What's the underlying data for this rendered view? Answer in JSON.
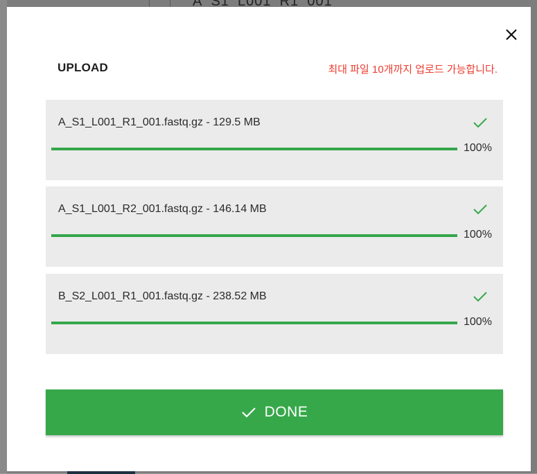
{
  "background": {
    "peek_text": "A_S1_L001_R1_001"
  },
  "modal": {
    "title": "UPLOAD",
    "notice": "최대 파일 10개까지 업로드 가능합니다.",
    "close_icon": "close-icon",
    "files": [
      {
        "name": "A_S1_L001_R1_001.fastq.gz - 129.5 MB",
        "progress_label": "100%",
        "progress": 1.0,
        "status_icon": "check-icon"
      },
      {
        "name": "A_S1_L001_R2_001.fastq.gz - 146.14 MB",
        "progress_label": "100%",
        "progress": 1.0,
        "status_icon": "check-icon"
      },
      {
        "name": "B_S2_L001_R1_001.fastq.gz - 238.52 MB",
        "progress_label": "100%",
        "progress": 1.0,
        "status_icon": "check-icon"
      }
    ],
    "done_button": {
      "label": "DONE",
      "icon": "check-icon"
    }
  },
  "colors": {
    "accent": "#37a84a",
    "notice": "#ec3b2f",
    "item_bg": "#ebebeb"
  }
}
